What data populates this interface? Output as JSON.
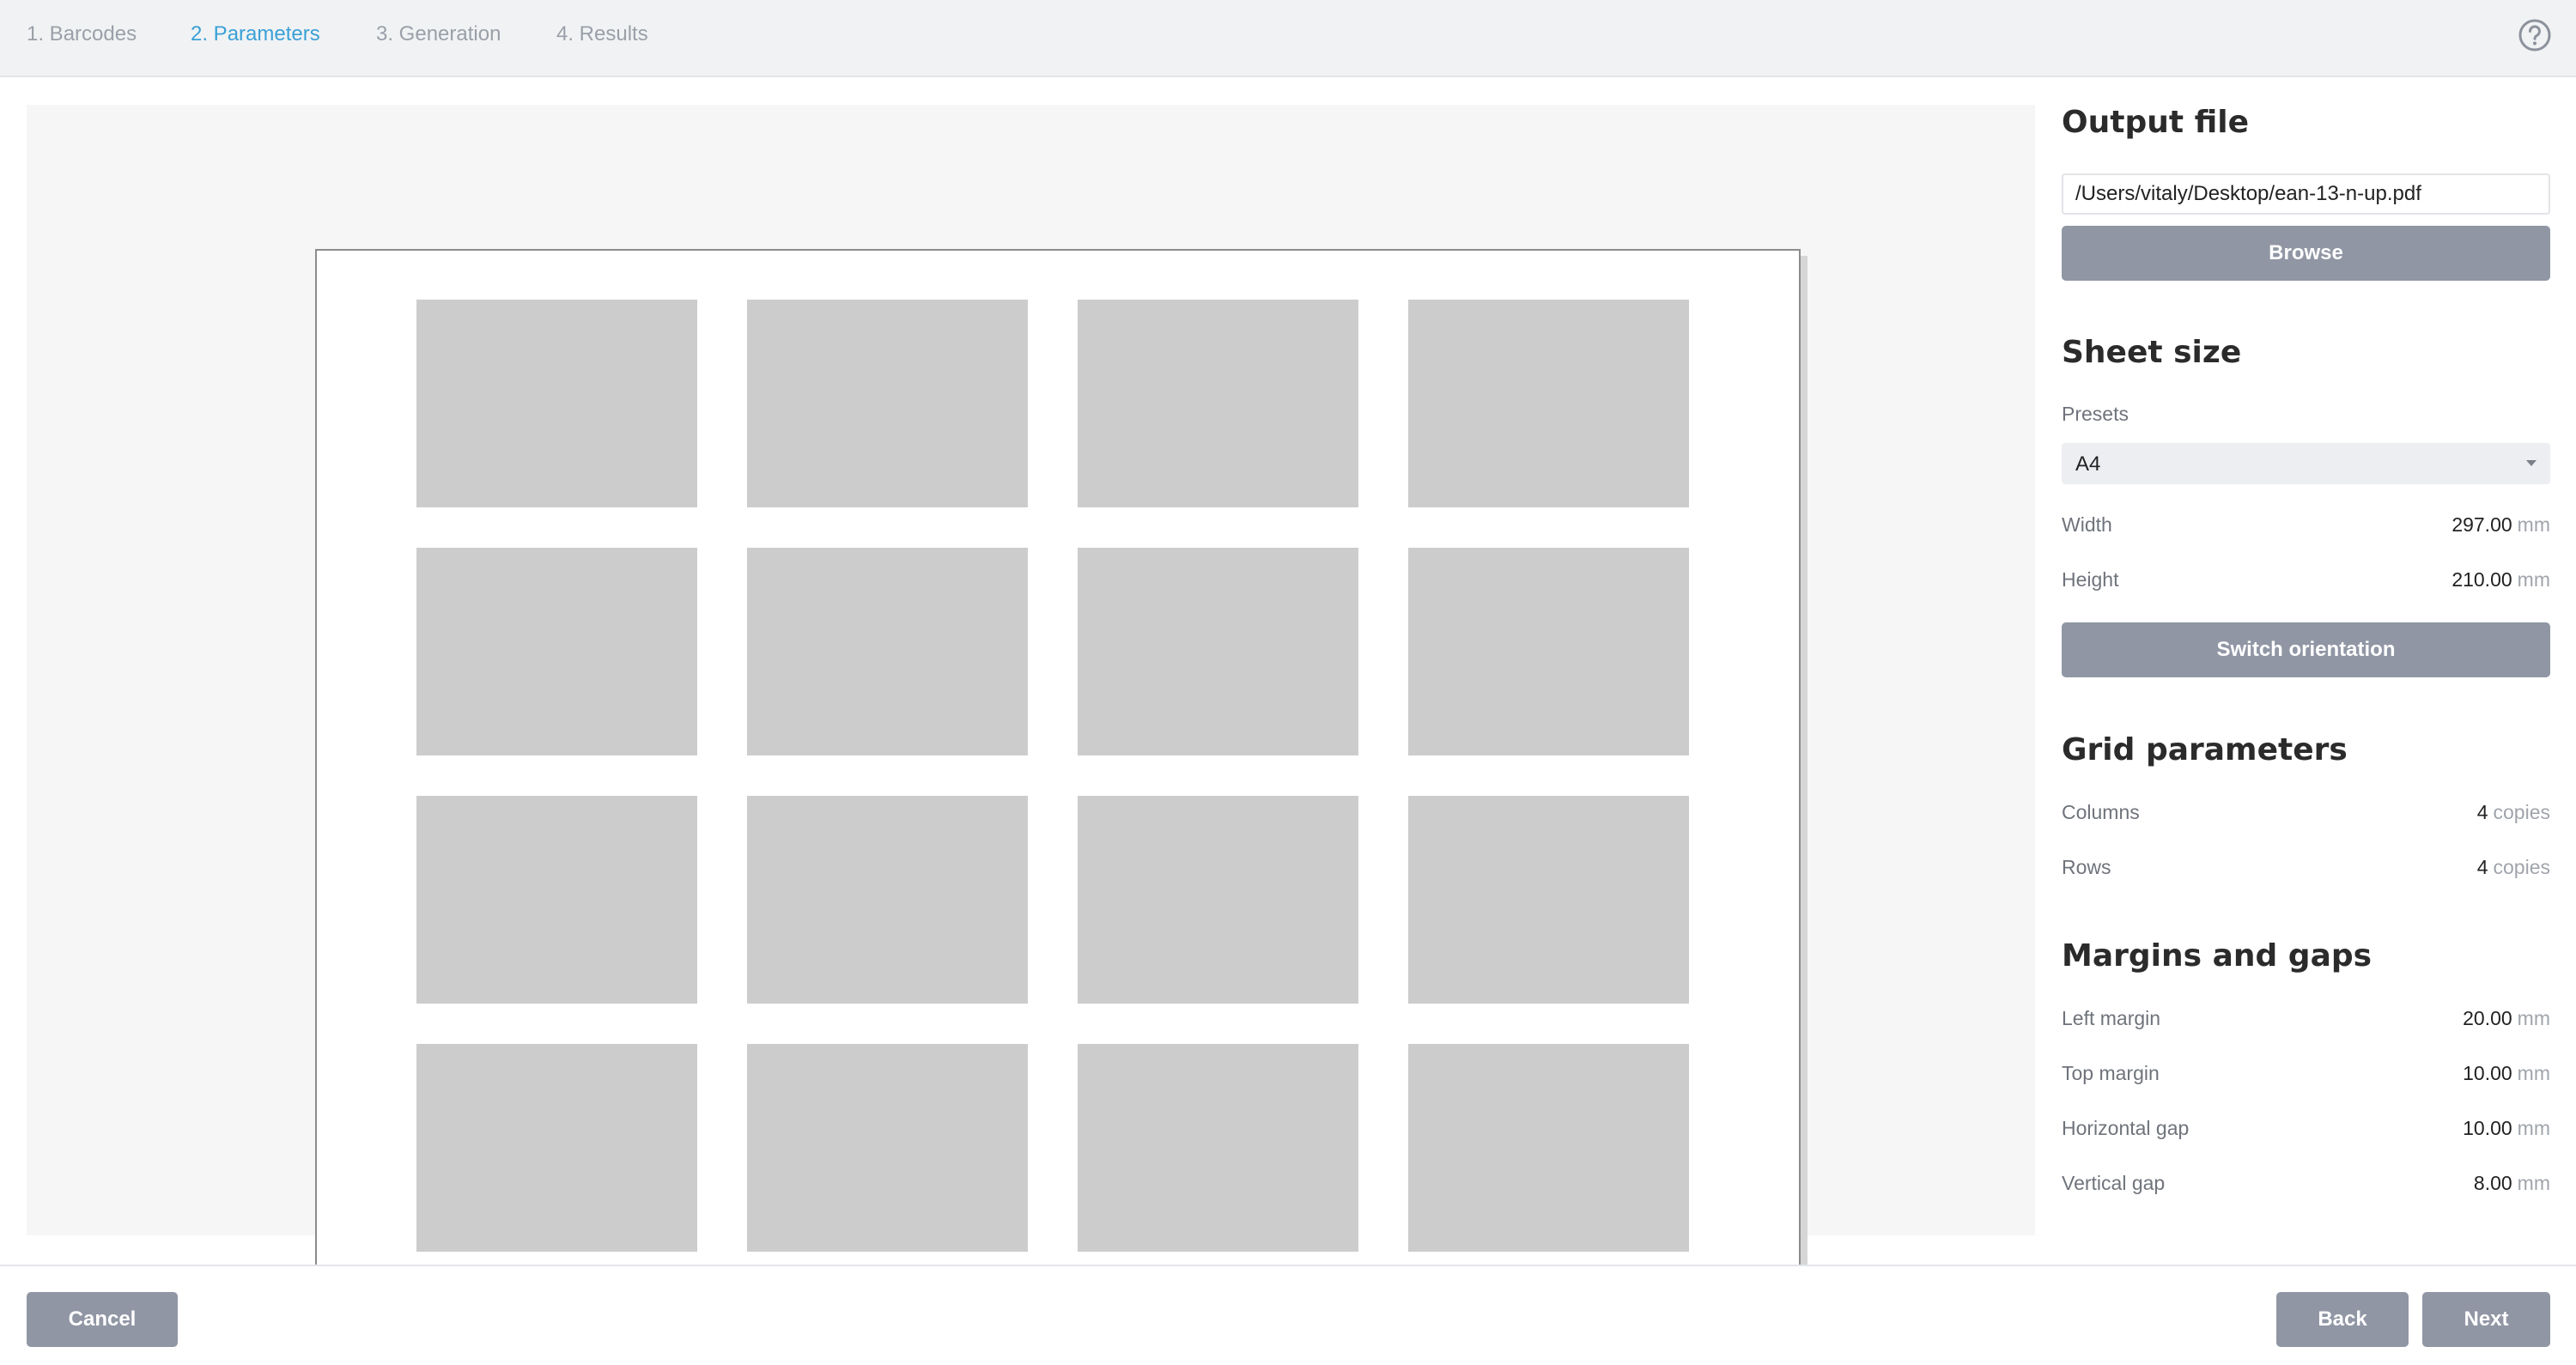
{
  "steps": [
    {
      "label": "1. Barcodes",
      "active": false
    },
    {
      "label": "2. Parameters",
      "active": true
    },
    {
      "label": "3. Generation",
      "active": false
    },
    {
      "label": "4. Results",
      "active": false
    }
  ],
  "help_icon": "question-circle-icon",
  "output_file": {
    "title": "Output file",
    "path": "/Users/vitaly/Desktop/ean-13-n-up.pdf",
    "browse_label": "Browse"
  },
  "sheet_size": {
    "title": "Sheet size",
    "presets_label": "Presets",
    "preset_value": "A4",
    "width_label": "Width",
    "width_value": "297.00",
    "height_label": "Height",
    "height_value": "210.00",
    "unit": "mm",
    "switch_label": "Switch orientation"
  },
  "grid": {
    "title": "Grid parameters",
    "columns_label": "Columns",
    "columns_value": "4",
    "rows_label": "Rows",
    "rows_value": "4",
    "unit": "copies"
  },
  "margins": {
    "title": "Margins and gaps",
    "left_label": "Left margin",
    "left_value": "20.00",
    "top_label": "Top margin",
    "top_value": "10.00",
    "hgap_label": "Horizontal gap",
    "hgap_value": "10.00",
    "vgap_label": "Vertical gap",
    "vgap_value": "8.00",
    "unit": "mm"
  },
  "footer": {
    "cancel_label": "Cancel",
    "back_label": "Back",
    "next_label": "Next"
  },
  "colors": {
    "accent": "#3aa0d6",
    "button": "#9096a4",
    "cell": "#cccccc"
  }
}
